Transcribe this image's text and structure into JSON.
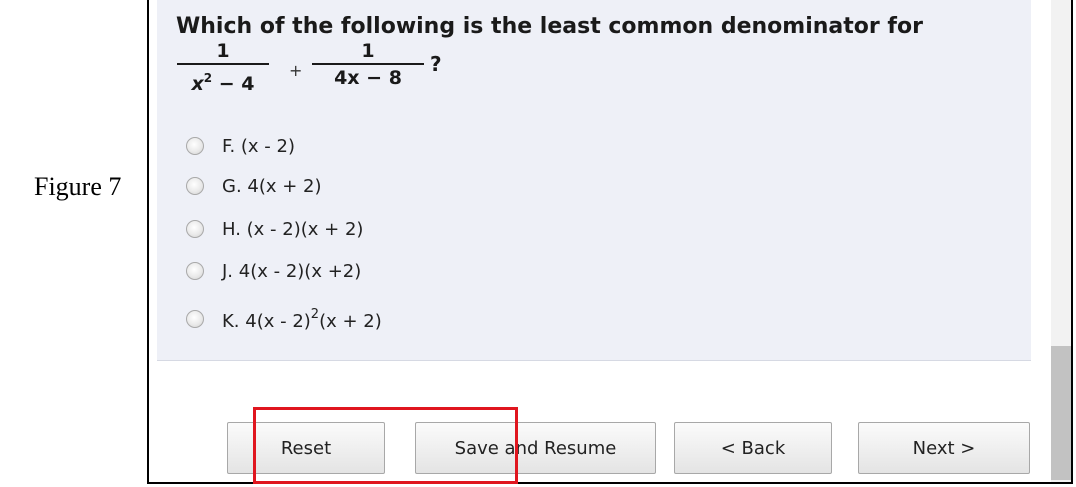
{
  "figure_label": "Figure 7",
  "question": {
    "text": "Which of the following is the least common denominator for",
    "fraction1": {
      "numerator": "1",
      "denominator_base": "x",
      "denominator_exp": "2",
      "denominator_rest": " − 4"
    },
    "operator": "+",
    "fraction2": {
      "numerator": "1",
      "denominator": "4x − 8"
    },
    "question_mark": "?"
  },
  "options": [
    {
      "label": "F. (x - 2)"
    },
    {
      "label": "G. 4(x + 2)"
    },
    {
      "label": "H. (x - 2)(x + 2)"
    },
    {
      "label": "J. 4(x - 2)(x +2)"
    },
    {
      "label_pre": "K. 4(x - 2)",
      "label_exp": "2",
      "label_post": "(x + 2)"
    }
  ],
  "buttons": {
    "reset": "Reset",
    "save_resume": "Save and Resume",
    "back": "< Back",
    "next": "Next >"
  },
  "colors": {
    "panel_bg": "#eef0f7",
    "highlight": "#e0161f"
  }
}
